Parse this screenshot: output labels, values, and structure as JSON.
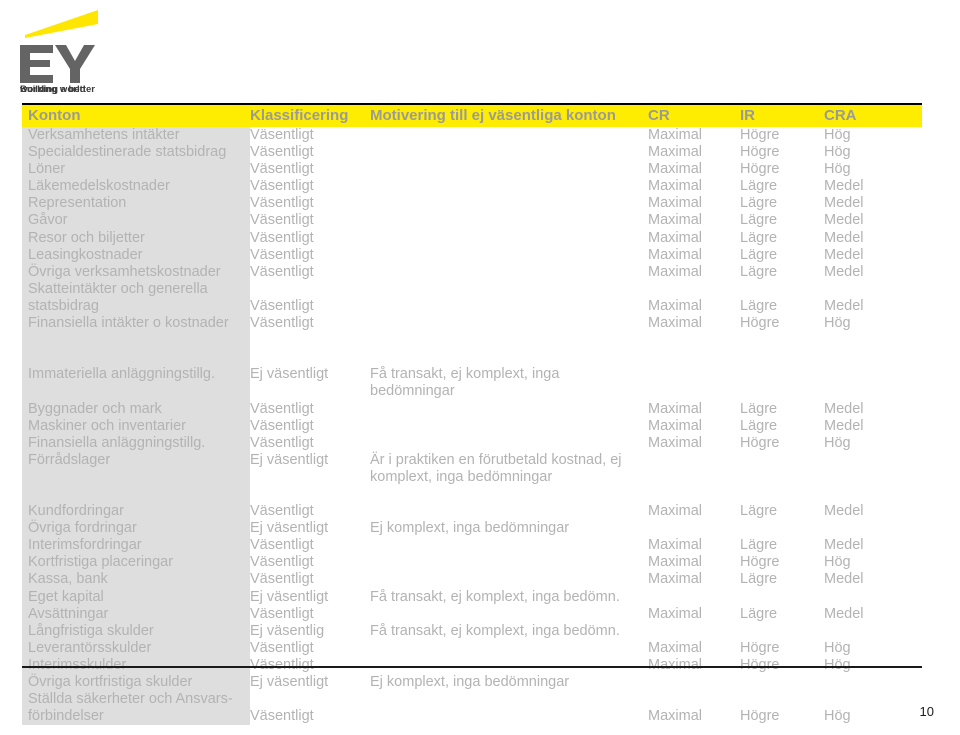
{
  "logo": {
    "brand": "EY",
    "tagline_line1": "Building a better",
    "tagline_line2": "working world",
    "accent_color": "#ffe600",
    "mark_color": "#646464"
  },
  "table": {
    "header_bg": "#ffed00",
    "header_text_color": "#9a9a9a",
    "row_label_bg": "#dedede",
    "body_text_color": "#b3b3b3",
    "columns": [
      "Konton",
      "Klassificering",
      "Motivering till ej väsentliga konton",
      "CR",
      "IR",
      "CRA"
    ],
    "groups": [
      {
        "rows": [
          {
            "konto": "Verksamhetens intäkter",
            "klass": "Väsentligt",
            "motivering": "",
            "cr": "Maximal",
            "ir": "Högre",
            "cra": "Hög"
          },
          {
            "konto": "Specialdestinerade statsbidrag",
            "klass": "Väsentligt",
            "motivering": "",
            "cr": "Maximal",
            "ir": "Högre",
            "cra": "Hög"
          },
          {
            "konto": "Löner",
            "klass": "Väsentligt",
            "motivering": "",
            "cr": "Maximal",
            "ir": "Högre",
            "cra": "Hög"
          },
          {
            "konto": "Läkemedelskostnader",
            "klass": "Väsentligt",
            "motivering": "",
            "cr": "Maximal",
            "ir": "Lägre",
            "cra": "Medel"
          },
          {
            "konto": "Representation",
            "klass": "Väsentligt",
            "motivering": "",
            "cr": "Maximal",
            "ir": "Lägre",
            "cra": "Medel"
          },
          {
            "konto": "Gåvor",
            "klass": "Väsentligt",
            "motivering": "",
            "cr": "Maximal",
            "ir": "Lägre",
            "cra": "Medel"
          },
          {
            "konto": "Resor och biljetter",
            "klass": "Väsentligt",
            "motivering": "",
            "cr": "Maximal",
            "ir": "Lägre",
            "cra": "Medel"
          },
          {
            "konto": "Leasingkostnader",
            "klass": "Väsentligt",
            "motivering": "",
            "cr": "Maximal",
            "ir": "Lägre",
            "cra": "Medel"
          },
          {
            "konto": "Övriga verksamhetskostnader",
            "klass": "Väsentligt",
            "motivering": "",
            "cr": "Maximal",
            "ir": "Lägre",
            "cra": "Medel"
          },
          {
            "konto": "Skatteintäkter och generella",
            "klass": "",
            "motivering": "",
            "cr": "",
            "ir": "",
            "cra": ""
          },
          {
            "konto": "statsbidrag",
            "klass": "Väsentligt",
            "motivering": "",
            "cr": "Maximal",
            "ir": "Lägre",
            "cra": "Medel"
          },
          {
            "konto": "Finansiella intäkter o kostnader",
            "klass": "Väsentligt",
            "motivering": "",
            "cr": "Maximal",
            "ir": "Högre",
            "cra": "Hög"
          }
        ]
      },
      {
        "rows": [
          {
            "konto": "Immateriella anläggningstillg.",
            "klass": "Ej väsentligt",
            "motivering": "Få transakt, ej komplext, inga bedömningar",
            "cr": "",
            "ir": "",
            "cra": ""
          },
          {
            "konto": "Byggnader och mark",
            "klass": "Väsentligt",
            "motivering": "",
            "cr": "Maximal",
            "ir": "Lägre",
            "cra": "Medel"
          },
          {
            "konto": "Maskiner och inventarier",
            "klass": "Väsentligt",
            "motivering": "",
            "cr": "Maximal",
            "ir": "Lägre",
            "cra": "Medel"
          },
          {
            "konto": "Finansiella anläggningstillg.",
            "klass": "Väsentligt",
            "motivering": "",
            "cr": "Maximal",
            "ir": "Högre",
            "cra": "Hög"
          },
          {
            "konto": "Förrådslager",
            "klass": "Ej väsentligt",
            "motivering": "Är i praktiken en förutbetald kostnad, ej",
            "cr": "",
            "ir": "",
            "cra": ""
          },
          {
            "konto": "",
            "klass": "",
            "motivering": "komplext, inga bedömningar",
            "cr": "",
            "ir": "",
            "cra": ""
          },
          {
            "konto": "Kundfordringar",
            "klass": "Väsentligt",
            "motivering": "",
            "cr": "Maximal",
            "ir": "Lägre",
            "cra": "Medel"
          },
          {
            "konto": "Övriga fordringar",
            "klass": "Ej väsentligt",
            "motivering": "Ej komplext, inga bedömningar",
            "cr": "",
            "ir": "",
            "cra": ""
          },
          {
            "konto": "Interimsfordringar",
            "klass": "Väsentligt",
            "motivering": "",
            "cr": "Maximal",
            "ir": "Lägre",
            "cra": "Medel"
          },
          {
            "konto": "Kortfristiga placeringar",
            "klass": "Väsentligt",
            "motivering": "",
            "cr": "Maximal",
            "ir": "Högre",
            "cra": "Hög"
          },
          {
            "konto": "Kassa, bank",
            "klass": "Väsentligt",
            "motivering": "",
            "cr": "Maximal",
            "ir": "Lägre",
            "cra": "Medel"
          },
          {
            "konto": "Eget kapital",
            "klass": "Ej väsentligt",
            "motivering": "Få transakt, ej komplext, inga bedömn.",
            "cr": "",
            "ir": "",
            "cra": ""
          },
          {
            "konto": "Avsättningar",
            "klass": "Väsentligt",
            "motivering": "",
            "cr": "Maximal",
            "ir": "Lägre",
            "cra": "Medel"
          },
          {
            "konto": "Långfristiga skulder",
            "klass": "Ej väsentlig",
            "motivering": "Få transakt, ej komplext, inga bedömn.",
            "cr": "",
            "ir": "",
            "cra": ""
          },
          {
            "konto": "Leverantörsskulder",
            "klass": "Väsentligt",
            "motivering": "",
            "cr": "Maximal",
            "ir": "Högre",
            "cra": "Hög"
          },
          {
            "konto": "Interimsskulder",
            "klass": "Väsentligt",
            "motivering": "",
            "cr": "Maximal",
            "ir": "Högre",
            "cra": "Hög"
          },
          {
            "konto": "Övriga kortfristiga skulder",
            "klass": "Ej väsentligt",
            "motivering": "Ej komplext, inga bedömningar",
            "cr": "",
            "ir": "",
            "cra": ""
          },
          {
            "konto": "Ställda säkerheter och Ansvars-",
            "klass": "",
            "motivering": "",
            "cr": "",
            "ir": "",
            "cra": ""
          },
          {
            "konto": "förbindelser",
            "klass": "Väsentligt",
            "motivering": "",
            "cr": "Maximal",
            "ir": "Högre",
            "cra": "Hög"
          }
        ]
      }
    ]
  },
  "footer": {
    "page_number": "10"
  }
}
